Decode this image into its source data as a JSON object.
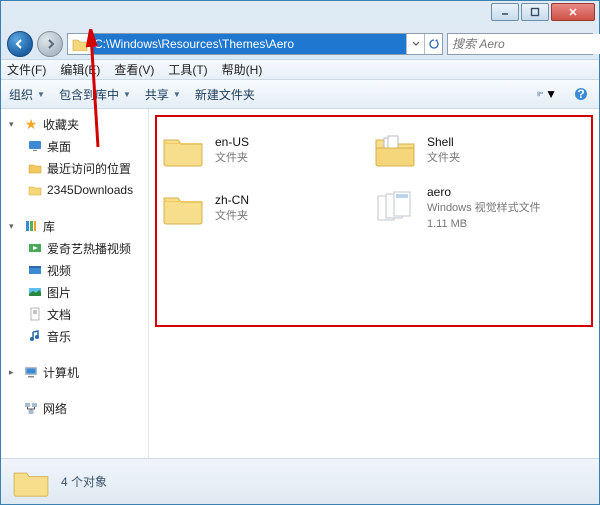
{
  "window": {
    "min_tip": "Minimize",
    "max_tip": "Maximize",
    "close_tip": "Close"
  },
  "nav": {
    "back_tip": "Back",
    "forward_tip": "Forward",
    "address": "C:\\Windows\\Resources\\Themes\\Aero",
    "refresh_tip": "Refresh"
  },
  "search": {
    "placeholder": "搜索 Aero"
  },
  "menus": {
    "file": "文件(F)",
    "edit": "编辑(E)",
    "view": "查看(V)",
    "tools": "工具(T)",
    "help": "帮助(H)"
  },
  "toolbar": {
    "organize": "组织",
    "include": "包含到库中",
    "share": "共享",
    "newfolder": "新建文件夹"
  },
  "sidebar": {
    "favorites": {
      "label": "收藏夹",
      "items": [
        {
          "icon": "desktop",
          "label": "桌面"
        },
        {
          "icon": "recent",
          "label": "最近访问的位置"
        },
        {
          "icon": "folder",
          "label": "2345Downloads"
        }
      ]
    },
    "libraries": {
      "label": "库",
      "items": [
        {
          "icon": "video",
          "label": "爱奇艺热播视频"
        },
        {
          "icon": "video",
          "label": "视频"
        },
        {
          "icon": "pictures",
          "label": "图片"
        },
        {
          "icon": "documents",
          "label": "文档"
        },
        {
          "icon": "music",
          "label": "音乐"
        }
      ]
    },
    "computer": {
      "label": "计算机"
    },
    "network": {
      "label": "网络"
    }
  },
  "content": {
    "items": [
      {
        "name": "en-US",
        "icon": "folder",
        "sub1": "文件夹",
        "sub2": ""
      },
      {
        "name": "Shell",
        "icon": "folderfiles",
        "sub1": "文件夹",
        "sub2": ""
      },
      {
        "name": "zh-CN",
        "icon": "folder",
        "sub1": "文件夹",
        "sub2": ""
      },
      {
        "name": "aero",
        "icon": "msstyles",
        "sub1": "Windows 视觉样式文件",
        "sub2": "1.11 MB"
      }
    ]
  },
  "status": {
    "text": "4 个对象"
  }
}
